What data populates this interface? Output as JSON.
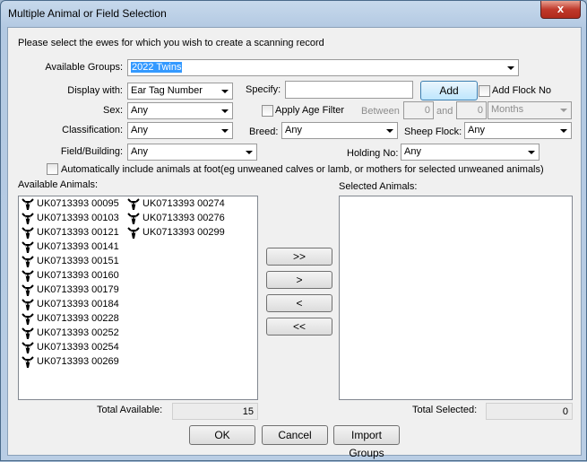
{
  "window": {
    "title": "Multiple Animal or Field Selection",
    "close_glyph": "x"
  },
  "instruction": "Please select the ewes for which you wish to create a scanning record",
  "groups": {
    "label": "Available Groups:",
    "value": "2022 Twins"
  },
  "display_with": {
    "label": "Display with:",
    "value": "Ear Tag Number"
  },
  "specify": {
    "label": "Specify:",
    "value": "",
    "add_label": "Add",
    "add_flock_label": "Add Flock No"
  },
  "sex": {
    "label": "Sex:",
    "value": "Any"
  },
  "age_filter": {
    "label": "Apply Age Filter",
    "between_label": "Between",
    "from": "0",
    "and_label": "and",
    "to": "0",
    "unit": "Months"
  },
  "classification": {
    "label": "Classification:",
    "value": "Any"
  },
  "breed": {
    "label": "Breed:",
    "value": "Any"
  },
  "sheep_flock": {
    "label": "Sheep Flock:",
    "value": "Any"
  },
  "field_building": {
    "label": "Field/Building:",
    "value": "Any"
  },
  "holding_no": {
    "label": "Holding No:",
    "value": "Any"
  },
  "auto_include": {
    "label": "Automatically include animals at foot(eg unweaned calves or lamb, or mothers for selected unweaned animals)"
  },
  "available": {
    "label": "Available Animals:",
    "items": [
      "UK0713393 00095",
      "UK0713393 00103",
      "UK0713393 00121",
      "UK0713393 00141",
      "UK0713393 00151",
      "UK0713393 00160",
      "UK0713393 00179",
      "UK0713393 00184",
      "UK0713393 00228",
      "UK0713393 00252",
      "UK0713393 00254",
      "UK0713393 00269",
      "UK0713393 00274",
      "UK0713393 00276",
      "UK0713393 00299"
    ],
    "item_icon": "sheep-icon",
    "total_label": "Total Available:",
    "total": "15"
  },
  "selected": {
    "label": "Selected Animals:",
    "items": [],
    "total_label": "Total Selected:",
    "total": "0"
  },
  "move_buttons": {
    "add_all": ">>",
    "add": ">",
    "remove": "<",
    "remove_all": "<<"
  },
  "footer": {
    "ok": "OK",
    "cancel": "Cancel",
    "import": "Import Groups"
  },
  "colors": {
    "selection": "#3399ff",
    "close_button": "#c0392b"
  }
}
